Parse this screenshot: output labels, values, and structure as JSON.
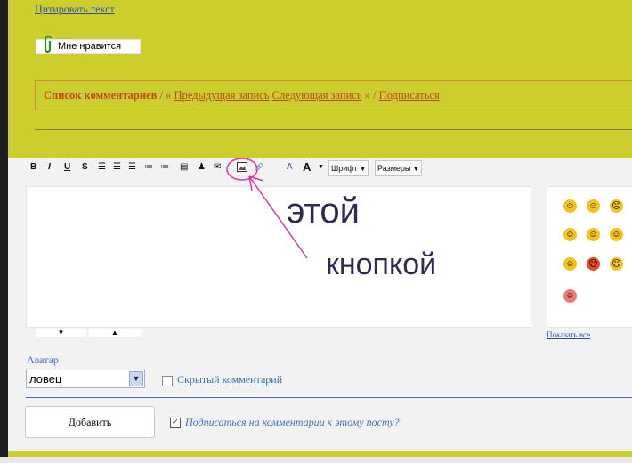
{
  "post": {
    "cite_link": "Цитировать текст",
    "like_button": "Мне нравится"
  },
  "comments_nav": {
    "title": "Список комментариев",
    "sep1": " / « ",
    "prev": "Предыдущая запись",
    "next": "Следующая запись",
    "sep2": " » / ",
    "subscribe": "Подписаться"
  },
  "toolbar": {
    "bold": "B",
    "italic": "I",
    "underline": "U",
    "strike": "S",
    "font_select": "Шрифт",
    "size_select": "Размеры"
  },
  "annotation": {
    "line1": "этой",
    "line2": "кнопкой"
  },
  "smiles": {
    "show_all": "Показать все"
  },
  "form": {
    "avatar_label": "Аватар",
    "avatar_value": "ловец",
    "hidden_comment": "Скрытый комментарий",
    "add_button": "Добавить",
    "subscribe_comments": "Подписаться на комментарии к этому посту?"
  },
  "colors": {
    "page_bg": "#ccce2e",
    "link": "#3b6ec4",
    "nav_text": "#c0461b",
    "annotation": "#d63aa6"
  }
}
